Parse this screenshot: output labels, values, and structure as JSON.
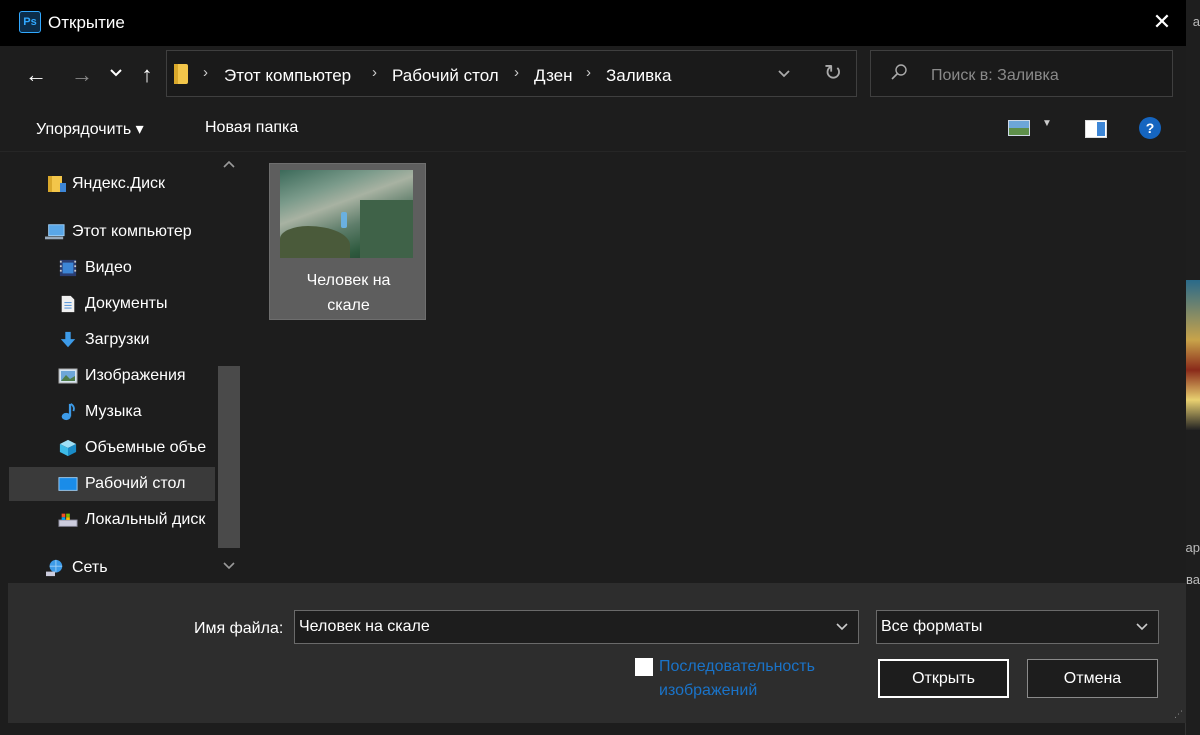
{
  "window": {
    "app_icon": "Ps",
    "title": "Открытие"
  },
  "navigation": {
    "back": "←",
    "forward": "→",
    "recent": "⌄",
    "up": "↑",
    "breadcrumbs": [
      "Этот компьютер",
      "Рабочий стол",
      "Дзен",
      "Заливка"
    ],
    "refresh": "↻"
  },
  "search": {
    "placeholder": "Поиск в: Заливка"
  },
  "toolbar": {
    "organize_label": "Упорядочить ▾",
    "new_folder_label": "Новая папка",
    "help_label": "?"
  },
  "sidebar": {
    "items": [
      {
        "label": "Яндекс.Диск",
        "icon": "folder-icon"
      },
      {
        "label": "Этот компьютер",
        "icon": "computer-icon"
      },
      {
        "label": "Видео",
        "icon": "video-icon"
      },
      {
        "label": "Документы",
        "icon": "documents-icon"
      },
      {
        "label": "Загрузки",
        "icon": "download-icon"
      },
      {
        "label": "Изображения",
        "icon": "pictures-icon"
      },
      {
        "label": "Музыка",
        "icon": "music-icon"
      },
      {
        "label": "Объемные объе",
        "icon": "3d-objects-icon"
      },
      {
        "label": "Рабочий стол",
        "icon": "desktop-icon",
        "selected": true
      },
      {
        "label": "Локальный диск",
        "icon": "drive-icon"
      },
      {
        "label": "Сеть",
        "icon": "network-icon"
      }
    ]
  },
  "files": [
    {
      "name_line1": "Человек на",
      "name_line2": "скале",
      "thumbnail": "person-on-cliff-photo"
    }
  ],
  "bottom": {
    "filename_label": "Имя файла:",
    "filename_value": "Человек на скале",
    "format_value": "Все форматы",
    "sequence_label_line1": "Последовательность",
    "sequence_label_line2": "изображений",
    "open_label": "Открыть",
    "cancel_label": "Отмена"
  },
  "backdrop": {
    "edge_text_1": "а",
    "edge_text_2": "Тар",
    "edge_text_3": "ва"
  },
  "colors": {
    "accent_link": "#1a73c8",
    "dialog_bg": "#1d1d1d",
    "help_blue": "#1565c0"
  }
}
